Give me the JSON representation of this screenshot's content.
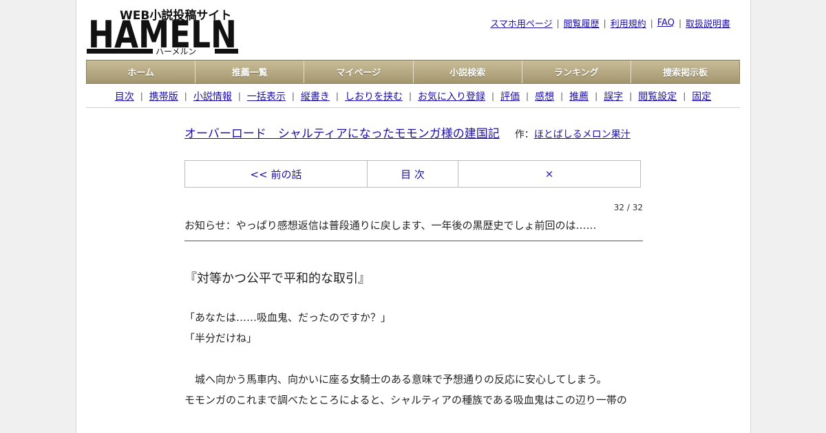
{
  "site": {
    "logo_text": "HAMELN",
    "logo_tagline": "WEB小説投稿サイト",
    "logo_kana": "ハーメルン"
  },
  "toplinks": [
    "スマホ用ページ",
    "閲覧履歴",
    "利用規約",
    "FAQ",
    "取扱説明書"
  ],
  "mainnav": [
    "ホーム",
    "推薦一覧",
    "マイページ",
    "小説検索",
    "ランキング",
    "捜索掲示板"
  ],
  "subnav": [
    "目次",
    "携帯版",
    "小説情報",
    "一括表示",
    "縦書き",
    "しおりを挟む",
    "お気に入り登録",
    "評価",
    "感想",
    "推薦",
    "誤字",
    "閲覧設定",
    "固定"
  ],
  "novel": {
    "title": "オーバーロード　シャルティアになったモモンガ様の建国記",
    "author_label": "作：",
    "author": "ほとばしるメロン果汁"
  },
  "chapnav": {
    "prev": "<< 前の話",
    "toc": "目 次",
    "next": "×"
  },
  "pager": "32 / 32",
  "notice": "お知らせ：やっぱり感想返信は普段通りに戻します、一年後の黒歴史でしょ前回のは……",
  "chapter_title": "『対等かつ公平で平和的な取引』",
  "body_lines": [
    "「あなたは……吸血鬼、だったのですか？」",
    "「半分だけね」",
    "",
    "　城へ向かう馬車内、向かいに座る女騎士のある意味で予想通りの反応に安心してしまう。",
    "モモンガのこれまで調べたところによると、シャルティアの種族である吸血鬼はこの辺り一帯の"
  ]
}
